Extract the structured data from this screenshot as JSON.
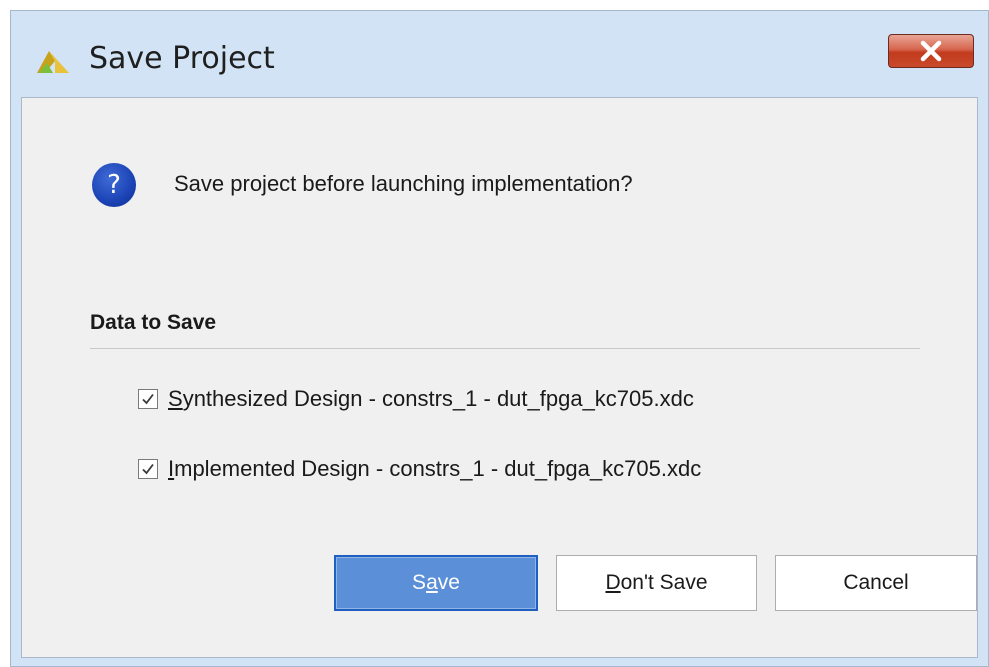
{
  "window": {
    "title": "Save Project",
    "app_icon": "vivado-logo-icon",
    "close_icon": "close-icon"
  },
  "dialog": {
    "question_icon": "question-icon",
    "question_glyph": "?",
    "message": "Save project before launching implementation?",
    "section_title": "Data to Save",
    "items": [
      {
        "mnemonic": "S",
        "label_rest": "ynthesized Design - constrs_1 - dut_fpga_kc705.xdc",
        "checked": true
      },
      {
        "mnemonic": "I",
        "label_rest": "mplemented Design - constrs_1 - dut_fpga_kc705.xdc",
        "checked": true
      }
    ]
  },
  "buttons": {
    "save": {
      "pre": "S",
      "mnemonic": "a",
      "post": "ve"
    },
    "dont_save": {
      "mnemonic": "D",
      "post": "on't Save"
    },
    "cancel": "Cancel"
  },
  "colors": {
    "accent": "#5b8fd8",
    "close": "#c9492c",
    "question": "#1b43b5"
  }
}
